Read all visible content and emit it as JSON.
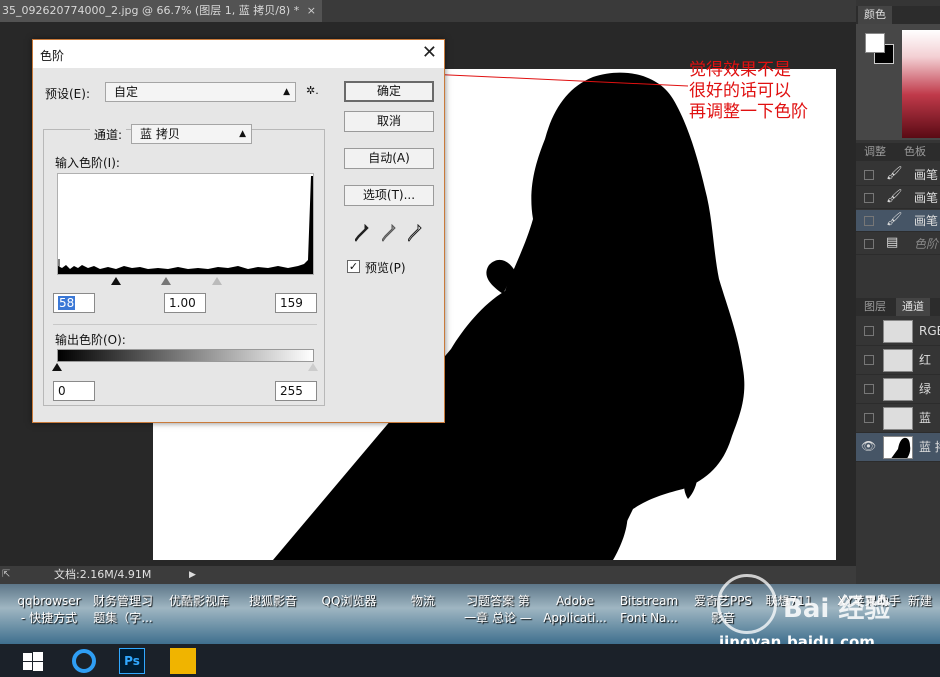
{
  "document_tab": {
    "title": "35_092620774000_2.jpg @ 66.7% (图层 1, 蓝 拷贝/8) *",
    "close": "×"
  },
  "status_bar": {
    "doc_info": "文档:2.16M/4.91M"
  },
  "right_panels": {
    "color_tab": "颜色",
    "adjust_tabs": [
      "调整",
      "色板"
    ],
    "history_items": [
      {
        "label": "画笔",
        "selected": false
      },
      {
        "label": "画笔",
        "selected": false
      },
      {
        "label": "画笔",
        "selected": true
      },
      {
        "label": "色阶",
        "selected": false,
        "dim": true
      }
    ],
    "channel_tabs": [
      "图层",
      "通道"
    ],
    "channels": [
      {
        "label": "RGB",
        "visible": false
      },
      {
        "label": "红",
        "visible": false
      },
      {
        "label": "绿",
        "visible": false
      },
      {
        "label": "蓝",
        "visible": false
      },
      {
        "label": "蓝 拷",
        "visible": true
      }
    ]
  },
  "dialog": {
    "title": "色阶",
    "close": "✕",
    "preset_label": "预设(E):",
    "preset_value": "自定",
    "channel_label": "通道:",
    "channel_value": "蓝 拷贝",
    "input_levels_label": "输入色阶(I):",
    "input_black": "58",
    "input_gamma": "1.00",
    "input_white": "159",
    "output_levels_label": "输出色阶(O):",
    "output_black": "0",
    "output_white": "255",
    "buttons": {
      "ok": "确定",
      "cancel": "取消",
      "auto": "自动(A)",
      "options": "选项(T)..."
    },
    "preview_label": "预览(P)",
    "preview_checked": true,
    "gear": "✲."
  },
  "annotation": {
    "lines": [
      "觉得效果不是",
      "很好的话可以",
      "再调整一下色阶"
    ],
    "color": "#e01010"
  },
  "desktop_icons": [
    {
      "line1": "qqbrowser",
      "line2": "- 快捷方式"
    },
    {
      "line1": "财务管理习",
      "line2": "题集（字..."
    },
    {
      "line1": "优酷影视库",
      "line2": ""
    },
    {
      "line1": "搜狐影音",
      "line2": ""
    },
    {
      "line1": "QQ浏览器",
      "line2": ""
    },
    {
      "line1": "物流",
      "line2": ""
    },
    {
      "line1": "习题答案 第",
      "line2": "一章 总论 —"
    },
    {
      "line1": "Adobe",
      "line2": "Applicati..."
    },
    {
      "line1": "Bitstream",
      "line2": "Font Na..."
    },
    {
      "line1": "爱奇艺PPS",
      "line2": "影音"
    },
    {
      "line1": "联想711",
      "line2": ""
    },
    {
      "line1": "XY苹果助手",
      "line2": ""
    },
    {
      "line1": "新建",
      "line2": ""
    }
  ],
  "taskbar": {
    "ps_label": "Ps"
  },
  "watermark": {
    "text": "Bai 经验",
    "url": "jingyan.baidu.com"
  }
}
